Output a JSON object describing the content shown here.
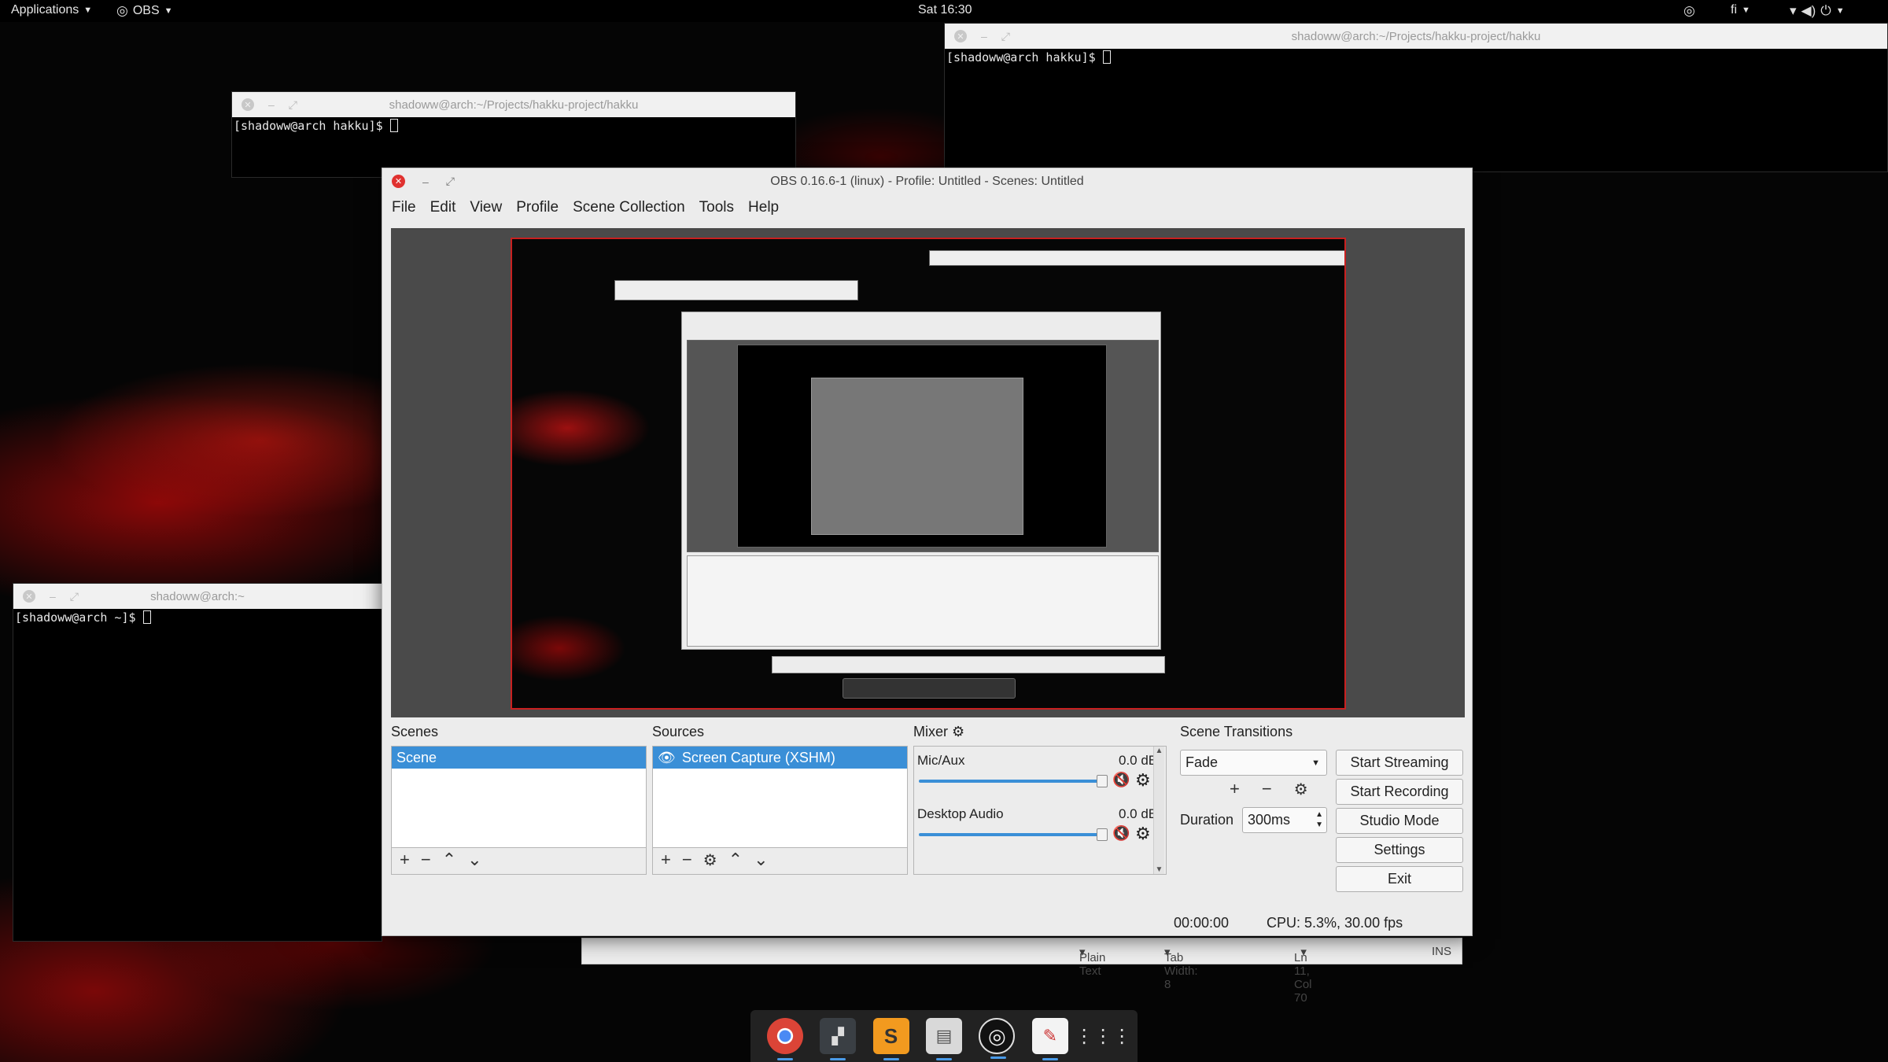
{
  "topbar": {
    "applications": "Applications",
    "obs_menu": "OBS",
    "clock": "Sat 16:30",
    "keyboard": "fi"
  },
  "terminals": [
    {
      "title": "shadoww@arch:~/Projects/hakku-project/hakku",
      "prompt": "[shadoww@arch hakku]$ "
    },
    {
      "title": "shadoww@arch:~/Projects/hakku-project/hakku",
      "prompt": "[shadoww@arch hakku]$ "
    },
    {
      "title": "shadoww@arch:~",
      "prompt": "[shadoww@arch ~]$ "
    }
  ],
  "obs": {
    "window_title": "OBS 0.16.6-1 (linux) - Profile: Untitled - Scenes: Untitled",
    "menu": [
      "File",
      "Edit",
      "View",
      "Profile",
      "Scene Collection",
      "Tools",
      "Help"
    ],
    "scenes": {
      "title": "Scenes",
      "items": [
        "Scene"
      ]
    },
    "sources": {
      "title": "Sources",
      "items": [
        "Screen Capture (XSHM)"
      ]
    },
    "mixer": {
      "title": "Mixer",
      "channels": [
        {
          "name": "Mic/Aux",
          "level": "0.0 dB",
          "volume": 0.98
        },
        {
          "name": "Desktop Audio",
          "level": "0.0 dB",
          "volume": 0.98
        }
      ]
    },
    "transitions": {
      "title": "Scene Transitions",
      "selected": "Fade",
      "duration_label": "Duration",
      "duration_value": "300ms"
    },
    "buttons": {
      "start_streaming": "Start Streaming",
      "start_recording": "Start Recording",
      "studio_mode": "Studio Mode",
      "settings": "Settings",
      "exit": "Exit"
    },
    "status": {
      "time": "00:00:00",
      "cpu": "CPU: 5.3%, 30.00 fps"
    }
  },
  "gedit_status": {
    "syntax": "Plain Text",
    "tab_width": "Tab Width: 8",
    "position": "Ln 11, Col 70",
    "mode": "INS"
  },
  "dock": [
    "chrome-icon",
    "terminal-icon",
    "sublime-icon",
    "files-icon",
    "obs-icon",
    "text-editor-icon",
    "app-grid-icon"
  ],
  "colors": {
    "accent": "#3a8fd7",
    "close": "#e0312f",
    "mute": "#d31c1c"
  }
}
